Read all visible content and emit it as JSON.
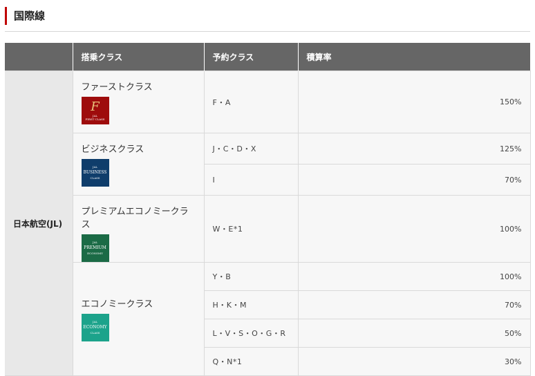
{
  "section_title": "国際線",
  "headers": [
    "",
    "搭乗クラス",
    "予約クラス",
    "積算率"
  ],
  "airline": "日本航空(JL)",
  "classes": [
    {
      "name": "ファーストクラス",
      "badge": {
        "line1": "F",
        "line2": "JAL",
        "line3": "FIRST CLASS",
        "color": "#9e0c0c"
      },
      "rows": [
        {
          "booking": "F・A",
          "rate": "150%"
        }
      ]
    },
    {
      "name": "ビジネスクラス",
      "badge": {
        "line1": "JAL",
        "line2": "BUSINESS",
        "line3": "CLASS",
        "color": "#0f3d6b"
      },
      "rows": [
        {
          "booking": "J・C・D・X",
          "rate": "125%"
        },
        {
          "booking": "I",
          "rate": "70%"
        }
      ]
    },
    {
      "name": "プレミアムエコノミークラス",
      "badge": {
        "line1": "JAL",
        "line2": "PREMIUM",
        "line3": "ECONOMY",
        "color": "#1b6b46"
      },
      "rows": [
        {
          "booking": "W・E*1",
          "rate": "100%"
        }
      ]
    },
    {
      "name": "エコノミークラス",
      "badge": {
        "line1": "JAL",
        "line2": "ECONOMY",
        "line3": "CLASS",
        "color": "#1ca38b"
      },
      "rows": [
        {
          "booking": "Y・B",
          "rate": "100%"
        },
        {
          "booking": "H・K・M",
          "rate": "70%"
        },
        {
          "booking": "L・V・S・O・G・R",
          "rate": "50%"
        },
        {
          "booking": "Q・N*1",
          "rate": "30%"
        }
      ]
    }
  ]
}
